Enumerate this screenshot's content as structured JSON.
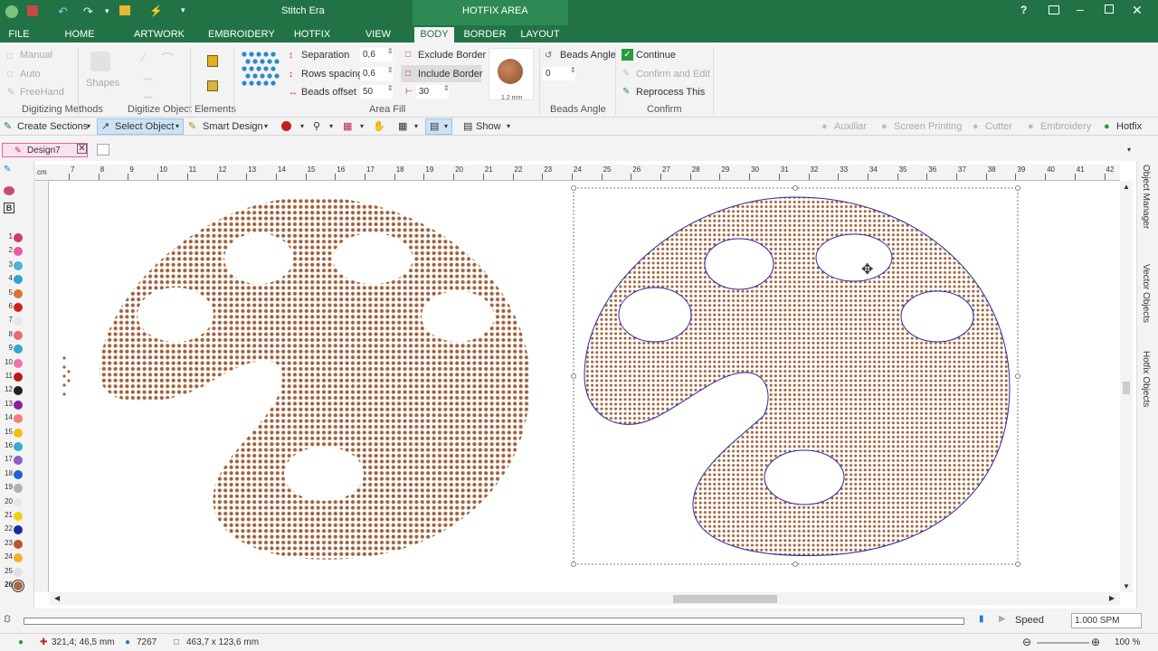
{
  "app": {
    "title": "Stitch Era",
    "context_tab": "HOTFIX AREA"
  },
  "menu": {
    "tabs": [
      "FILE",
      "HOME",
      "ARTWORK",
      "EMBROIDERY",
      "HOTFIX",
      "VIEW",
      "BODY",
      "BORDER",
      "LAYOUT"
    ],
    "active": "BODY"
  },
  "ribbon": {
    "digitize": {
      "manual": "Manual",
      "auto": "Auto",
      "freehand": "FreeHand",
      "group": "Digitizing Methods"
    },
    "shapes": {
      "label": "Shapes",
      "group": "Digitize Object"
    },
    "elements": {
      "group": "Elements"
    },
    "areafill": {
      "separation_label": "Separation",
      "separation_value": "0,6",
      "rows_label": "Rows spacing",
      "rows_value": "0,6",
      "offset_label": "Beads offset",
      "offset_value": "50",
      "exclude": "Exclude Border",
      "include": "Include Border",
      "count_value": "30",
      "size_label": "1.2 mm",
      "group": "Area Fill"
    },
    "angle": {
      "label": "Beads Angle",
      "value": "0",
      "group": "Beads Angle"
    },
    "confirm": {
      "continue": "Continue",
      "confirm_edit": "Confirm and Edit",
      "reprocess": "Reprocess This",
      "group": "Confirm"
    }
  },
  "toolbar": {
    "create_sections": "Create Sections",
    "select_object": "Select Object",
    "smart_design": "Smart Design",
    "show": "Show",
    "modes": [
      "Auxiliar",
      "Screen Printing",
      "Cutter",
      "Embroidery",
      "Hotfix"
    ]
  },
  "document": {
    "tab": "Design7"
  },
  "ruler": {
    "unit": "cm",
    "ticks": [
      "7",
      "8",
      "9",
      "10",
      "11",
      "12",
      "13",
      "14",
      "15",
      "16",
      "17",
      "18",
      "19",
      "20",
      "21",
      "22",
      "23",
      "24",
      "25",
      "26",
      "27",
      "28",
      "29",
      "30",
      "31",
      "32",
      "33",
      "34",
      "35",
      "36",
      "37",
      "38",
      "39",
      "40",
      "41",
      "42"
    ]
  },
  "palette": {
    "numbers": [
      "1",
      "2",
      "3",
      "4",
      "5",
      "6",
      "7",
      "8",
      "9",
      "10",
      "11",
      "12",
      "13",
      "14",
      "15",
      "16",
      "17",
      "18",
      "19",
      "20",
      "21",
      "22",
      "23",
      "24",
      "25",
      "26"
    ],
    "colors": [
      "#d23a6a",
      "#e85aa0",
      "#4fb0d8",
      "#2fa2d0",
      "#e07030",
      "#d02020",
      "#e8e8e8",
      "#e86a6a",
      "#30a8d0",
      "#f070b0",
      "#c01818",
      "#222222",
      "#8a20a0",
      "#f08080",
      "#f0c010",
      "#30b0c0",
      "#8a60c0",
      "#2060d0",
      "#b0b0b0",
      "#e8e8e8",
      "#f0d010",
      "#1a2aa0",
      "#c05030",
      "#f0b030",
      "#e0e0e0",
      "#a86a44"
    ],
    "active_index": 25
  },
  "panels": {
    "right": [
      "Object Manager",
      "Vector Objects",
      "Hotfix Objects"
    ]
  },
  "colors": {
    "accent": "#217346",
    "bead": "#a0623c",
    "outline": "#2a2aa0"
  },
  "status": {
    "coords": "321,4; 46,5 mm",
    "count": "7267",
    "size": "463,7 x 123,6 mm",
    "zoom": "100 %",
    "speed_label": "Speed",
    "speed_value": "1.000 SPM"
  }
}
